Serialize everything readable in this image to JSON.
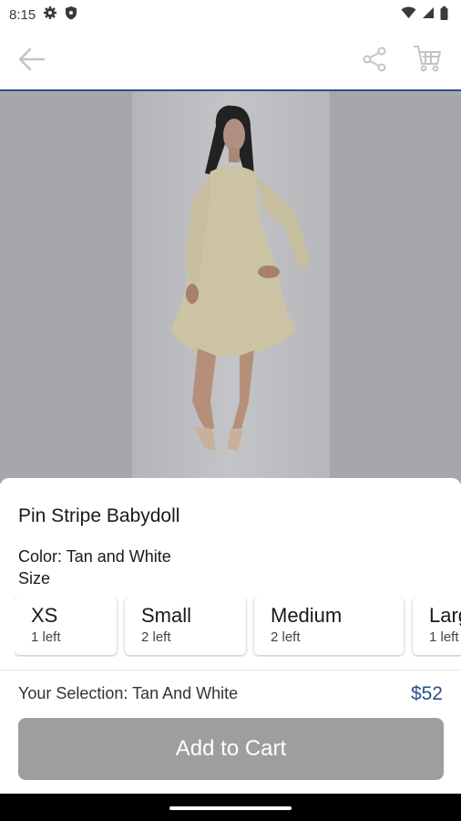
{
  "status_bar": {
    "time": "8:15"
  },
  "product": {
    "title": "Pin Stripe Babydoll",
    "color_line": "Color: Tan and White",
    "size_label": "Size"
  },
  "sizes": [
    {
      "name": "XS",
      "stock": "1 left"
    },
    {
      "name": "Small",
      "stock": "2 left"
    },
    {
      "name": "Medium",
      "stock": "2 left"
    },
    {
      "name": "Large",
      "stock": "1 left"
    }
  ],
  "selection": {
    "text": "Your Selection: Tan And White",
    "price": "$52"
  },
  "cart_button": {
    "label": "Add to Cart"
  },
  "colors": {
    "accent": "#2b4f8f",
    "button": "#9e9e9e",
    "backdrop": "#a6a7ab"
  },
  "icons": [
    "gear-icon",
    "shield-icon",
    "wifi-icon",
    "signal-icon",
    "battery-icon",
    "back-arrow-icon",
    "share-icon",
    "cart-icon"
  ]
}
